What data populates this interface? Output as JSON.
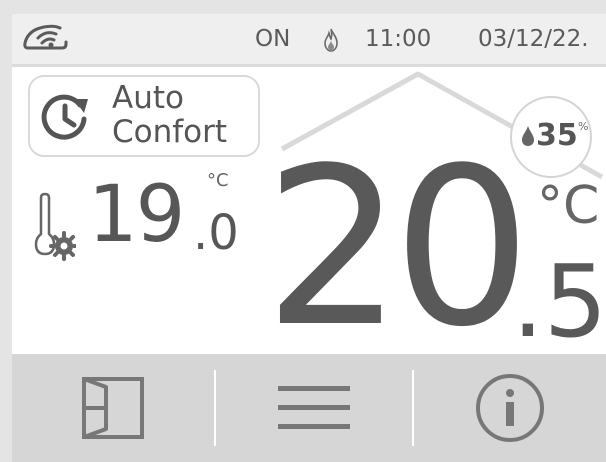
{
  "status_bar": {
    "wifi_icon": "wifi-icon",
    "power": "ON",
    "flame_icon": "flame-icon",
    "time": "11:00",
    "date": "03/12/22."
  },
  "mode": {
    "icon": "schedule-clock-icon",
    "line1": "Auto",
    "line2": "Confort"
  },
  "humidity": {
    "icon": "water-drop-icon",
    "value": "35",
    "unit": "%"
  },
  "setpoint": {
    "icon": "thermometer-settings-icon",
    "integer": "19",
    "decimal": ".0",
    "unit": "°C"
  },
  "current_temperature": {
    "integer": "20",
    "decimal": ".5",
    "unit": "°C"
  },
  "bottom_bar": {
    "buttons": [
      {
        "icon": "door-icon"
      },
      {
        "icon": "menu-icon"
      },
      {
        "icon": "info-icon"
      }
    ]
  },
  "colors": {
    "background": "#ffffff",
    "status_bar": "#efefef",
    "bottom_bar": "#d6d6d6",
    "text": "#555555",
    "roof_line": "#d9d9d9"
  }
}
